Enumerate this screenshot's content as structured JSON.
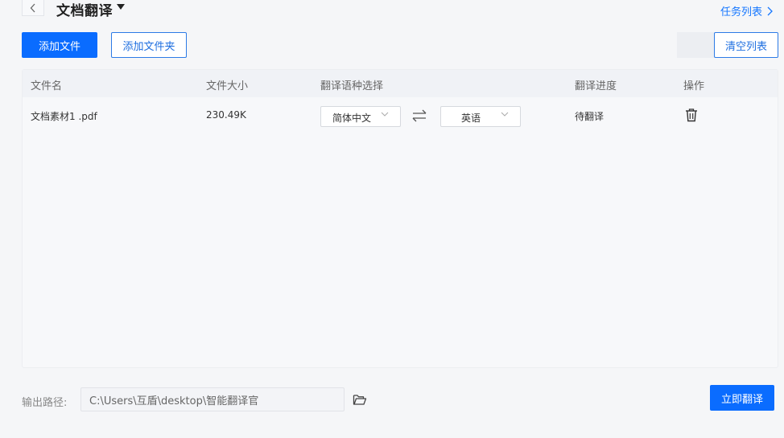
{
  "header": {
    "back_icon": "chevron-left-icon",
    "title": "文档翻译",
    "title_caret_icon": "caret-down-icon",
    "task_list_label": "任务列表",
    "task_list_icon": "chevron-right-icon"
  },
  "toolbar": {
    "add_file_label": "添加文件",
    "add_folder_label": "添加文件夹",
    "clear_list_label": "清空列表"
  },
  "table": {
    "columns": [
      "文件名",
      "文件大小",
      "翻译语种选择",
      "翻译进度",
      "操作"
    ],
    "rows": [
      {
        "file_name": "文档素材1 .pdf",
        "file_size": "230.49K",
        "source_language": "简体中文",
        "target_language": "英语",
        "progress": "待翻译",
        "action_icon": "trash-icon"
      }
    ]
  },
  "footer": {
    "output_label": "输出路径:",
    "output_path": "C:\\Users\\互盾\\desktop\\智能翻译官",
    "folder_icon": "folder-open-icon",
    "translate_label": "立即翻译"
  },
  "colors": {
    "primary": "#0a6cff",
    "link": "#1677ff",
    "background": "#f5f6f8"
  }
}
